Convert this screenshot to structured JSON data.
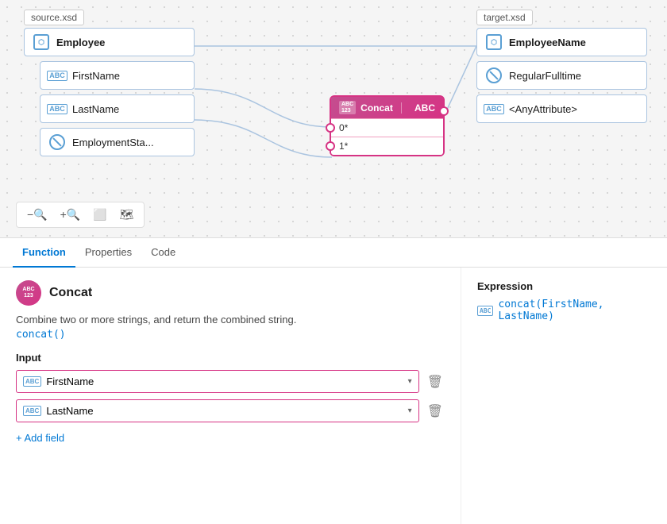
{
  "canvas": {
    "source_label": "source.xsd",
    "target_label": "target.xsd",
    "source_nodes": {
      "parent": {
        "label": "Employee",
        "icon": "cube"
      },
      "children": [
        {
          "label": "FirstName",
          "icon": "abc"
        },
        {
          "label": "LastName",
          "icon": "abc"
        },
        {
          "label": "EmploymentSta...",
          "icon": "banned"
        }
      ]
    },
    "target_nodes": [
      {
        "label": "EmployeeName",
        "icon": "cube"
      },
      {
        "label": "RegularFulltime",
        "icon": "banned"
      },
      {
        "label": "<AnyAttribute>",
        "icon": "abc"
      }
    ],
    "concat_node": {
      "title": "Concat",
      "abc_label": "ABC",
      "input0": "0*",
      "input1": "1*"
    },
    "toolbar_buttons": [
      {
        "icon": "🔍-",
        "label": "zoom-out"
      },
      {
        "icon": "🔍+",
        "label": "zoom-in"
      },
      {
        "icon": "⬜",
        "label": "fit"
      },
      {
        "icon": "🗺",
        "label": "map"
      }
    ]
  },
  "bottom_panel": {
    "tabs": [
      {
        "label": "Function",
        "active": true
      },
      {
        "label": "Properties",
        "active": false
      },
      {
        "label": "Code",
        "active": false
      }
    ],
    "function": {
      "name": "Concat",
      "icon_text": "ABC\n123",
      "description": "Combine two or more strings, and return the combined string.",
      "code": "concat()",
      "input_label": "Input",
      "inputs": [
        {
          "value": "FirstName",
          "icon": "ABC"
        },
        {
          "value": "LastName",
          "icon": "ABC"
        }
      ],
      "add_field_label": "+ Add field"
    },
    "expression": {
      "label": "Expression",
      "icon": "ABC",
      "value": "concat(FirstName, LastName)"
    }
  }
}
